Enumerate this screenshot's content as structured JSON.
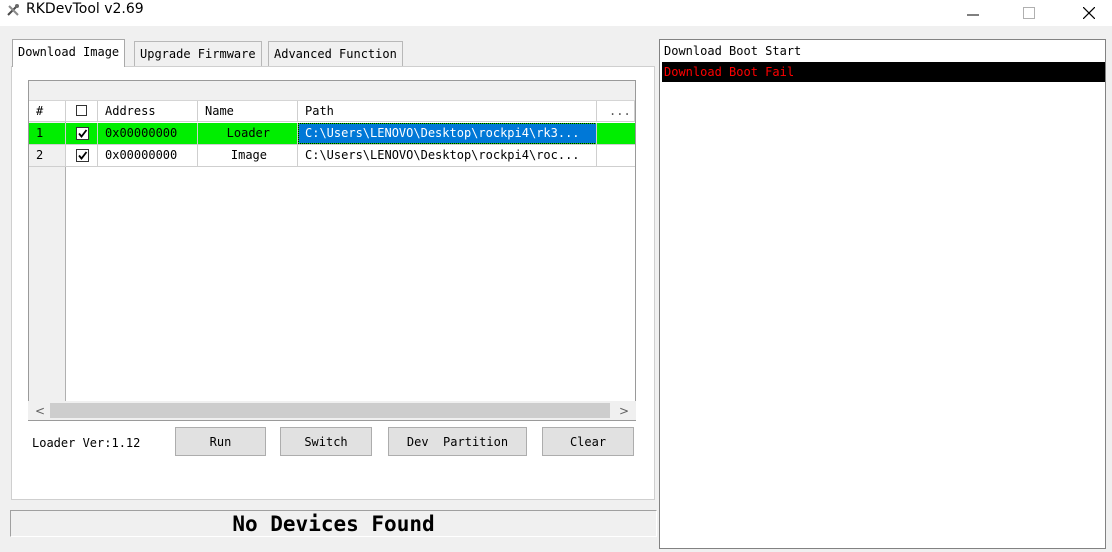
{
  "window": {
    "title": "RKDevTool v2.69",
    "minimize_glyph": "—",
    "maximize_glyph": "☐",
    "close_glyph": "✕",
    "icon": "rk-app-icon"
  },
  "tabs": [
    {
      "label": "Download Image",
      "active": true
    },
    {
      "label": "Upgrade Firmware",
      "active": false
    },
    {
      "label": "Advanced Function",
      "active": false
    }
  ],
  "table": {
    "headers": {
      "index": "#",
      "address": "Address",
      "name": "Name",
      "path": "Path",
      "more": "..."
    },
    "rows": [
      {
        "index": "1",
        "checked": true,
        "address": "0x00000000",
        "name": "Loader",
        "path": "C:\\Users\\LENOVO\\Desktop\\rockpi4\\rk3...",
        "highlight": "#00ee00",
        "path_selected": true
      },
      {
        "index": "2",
        "checked": true,
        "address": "0x00000000",
        "name": "Image",
        "path": "C:\\Users\\LENOVO\\Desktop\\rockpi4\\roc...",
        "highlight": "",
        "path_selected": false
      }
    ],
    "scroll_left": "<",
    "scroll_right": ">"
  },
  "footer": {
    "loader_ver": "Loader Ver:1.12",
    "buttons": {
      "run": "Run",
      "switch": "Switch",
      "dev_partition": "Dev  Partition",
      "clear": "Clear"
    }
  },
  "status": {
    "text": "No Devices Found"
  },
  "log": {
    "lines": [
      {
        "text": "Download Boot Start",
        "color": "#000000",
        "bg": "#ffffff"
      },
      {
        "text": "Download Boot Fail",
        "color": "#ff0000",
        "bg": "#000000"
      }
    ]
  },
  "colors": {
    "row_highlight": "#00ee00",
    "selection": "#0078d7",
    "fail_text": "#ff0000"
  }
}
